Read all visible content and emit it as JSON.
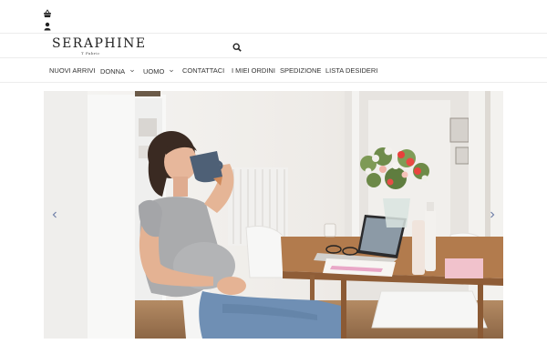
{
  "header": {
    "icons": [
      "basket-icon",
      "user-icon"
    ]
  },
  "brand": {
    "logo": "SERAPHINE",
    "tagline": "T Fabric"
  },
  "nav": {
    "items": [
      {
        "label": "NUOVI ARRIVI"
      },
      {
        "label": "DONNA"
      },
      {
        "label": "UOMO"
      },
      {
        "label": "CONTATTACI"
      },
      {
        "label": "I MIEI ORDINI"
      },
      {
        "label": "SPEDIZIONE"
      },
      {
        "label": "LISTA DESIDERI"
      }
    ]
  },
  "hero": {
    "description_colors": {
      "wall": "#f3f1ee",
      "table": "#b07a4e",
      "shirt": "#a9aaad",
      "jeans": "#6f8fb4"
    }
  },
  "colors": {
    "accent": "#222222",
    "border": "#ececec"
  }
}
